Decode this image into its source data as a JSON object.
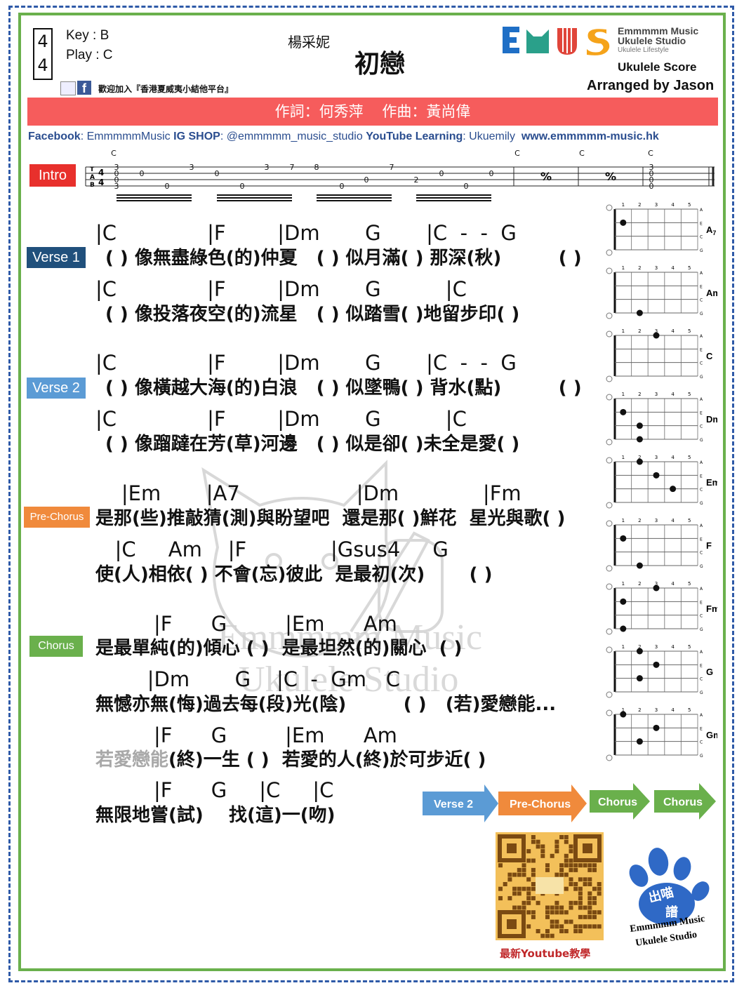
{
  "header": {
    "time_sig_top": "4",
    "time_sig_bottom": "4",
    "key": "Key  : B",
    "play": "Play : C",
    "artist": "楊采妮",
    "title": "初戀",
    "join_text": "歡迎加入『香港夏威夷小結他平台』",
    "brand_line1": "Emmmmm Music",
    "brand_line2": "Ukulele Studio",
    "brand_line3": "Ukulele Lifestyle",
    "score_label": "Ukulele Score",
    "arranged_by": "Arranged by Jason",
    "credits": "作詞：何秀萍    作曲：黃尚偉"
  },
  "social": {
    "fb_label": "Facebook",
    "fb_value": ": EmmmmmMusic ",
    "ig_label": "IG SHOP",
    "ig_value": ": @emmmmm_music_studio ",
    "yt_label": "YouTube Learning",
    "yt_value": ": Ukuemily  ",
    "website": "www.emmmmm-music.hk"
  },
  "intro": {
    "label": "Intro",
    "chord_labels": [
      "C",
      "C",
      "C",
      "C"
    ],
    "tab_numbers": [
      "3",
      "0",
      "0",
      "3",
      "0",
      "3",
      "7",
      "8",
      "0",
      "0",
      "7",
      "0",
      "2",
      "0",
      "0",
      "3",
      "0",
      "0",
      "0"
    ],
    "repeat_symbol": "%"
  },
  "sections": {
    "verse1": "Verse 1",
    "verse2": "Verse 2",
    "prechorus": "Pre-Chorus",
    "chorus": "Chorus"
  },
  "lines": [
    {
      "chords": "|C              |F        |Dm       G       |C  -  -  G",
      "lyrics": "( ) 像無盡綠色(的)仲夏   ( ) 似月滿( ) 那深(秋)         ( )"
    },
    {
      "chords": "|C              |F        |Dm       G          |C",
      "lyrics": "( ) 像投落夜空(的)流星   ( ) 似踏雪( )地留步印( )"
    },
    {
      "chords": "|C              |F        |Dm       G       |C  -  -  G",
      "lyrics": "( ) 像橫越大海(的)白浪   ( ) 似墜鴨( ) 背水(點)         ( )"
    },
    {
      "chords": "|C              |F        |Dm       G          |C",
      "lyrics": "( ) 像蹓躂在芳(草)河邊   ( ) 似是卻( )未全是愛( )"
    },
    {
      "chords": "    |Em       |A7                  |Dm             |Fm",
      "lyrics": "是那(些)推敲猜(測)與盼望吧  還是那( )鮮花  星光與歌( )"
    },
    {
      "chords": "   |C     Am    |F             |Gsus4     G",
      "lyrics": "使(人)相依( ) 不會(忘)彼此  是最初(次)       ( )"
    },
    {
      "chords": "         |F      G         |Em      Am",
      "lyrics": "是最單純(的)傾心 ( )  是最坦然(的)關心  ( )"
    },
    {
      "chords": "        |Dm       G    |C  -  Gm   C",
      "lyrics": "無憾亦無(悔)過去每(段)光(陰)         ( )   (若)愛戀能..."
    },
    {
      "chords": "         |F      G         |Em      Am",
      "lyrics_grey": "若愛戀能",
      "lyrics": "(終)一生 ( )  若愛的人(終)於可步近( )"
    },
    {
      "chords": "         |F      G     |C     |C",
      "lyrics": "無限地嘗(試)    找(這)一(吻)"
    }
  ],
  "chord_sub": {
    "A7": "7",
    "Gsus4": "sus4"
  },
  "chord_diagrams": [
    "A7",
    "Am",
    "C",
    "Dm",
    "Em",
    "F",
    "Fm",
    "G",
    "Gm"
  ],
  "fret_numbers": [
    "1",
    "2",
    "3",
    "4",
    "5"
  ],
  "string_letters": [
    "A",
    "E",
    "C",
    "G"
  ],
  "roadmap": [
    "Verse 2",
    "Pre-Chorus",
    "Chorus",
    "Chorus"
  ],
  "qr_caption": "最新Youtube教學",
  "paw": {
    "text1": "出喵",
    "text2": "譜",
    "text3": "Emmmmm Music",
    "text4": "Ukulele Studio"
  },
  "colors": {
    "banner_red": "#f65c5c",
    "verse1": "#20507c",
    "verse2": "#5b9bd5",
    "prechorus": "#f08a3c",
    "chorus": "#6ab04c",
    "frame_blue": "#2f5aa8",
    "frame_green": "#6ab04c",
    "link_blue": "#2a4d8f",
    "logo_blue": "#1f6fc6",
    "logo_green": "#2aa08a",
    "logo_red": "#e0453a",
    "logo_orange": "#f5a31a"
  },
  "icons": [
    "weibo-icon",
    "facebook-icon",
    "qr-code",
    "paw-logo",
    "cat-watermark"
  ]
}
